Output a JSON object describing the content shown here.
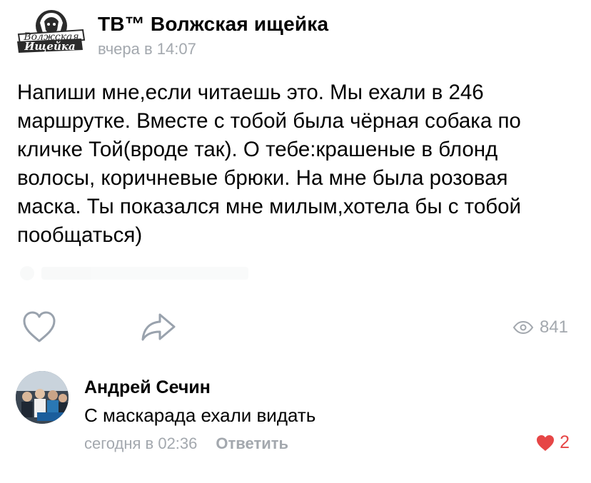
{
  "post": {
    "group_name": "ТВ™ Волжская ищейка",
    "time": "вчера в 14:07",
    "logo_text": {
      "line1": "Волжская",
      "line2": "Ищейка"
    },
    "text": "Напиши мне,если читаешь это. Мы ехали в 246 маршрутке. Вместе с тобой была чёрная собака по кличке Той(вроде так). О тебе:крашеные в блонд волосы, коричневые брюки. На мне была розовая маска. Ты показался мне милым,хотела бы с тобой пообщаться)",
    "views": "841"
  },
  "icons": {
    "like": "heart-outline-icon",
    "share": "share-arrow-icon",
    "views": "eye-icon",
    "comment_like": "heart-filled-icon"
  },
  "comment": {
    "author": "Андрей Сечин",
    "text": "С маскарада ехали видать",
    "time": "сегодня в 02:36",
    "reply_label": "Ответить",
    "likes": "2"
  },
  "colors": {
    "muted": "#a3a8ae",
    "like_red": "#e64646",
    "icon_gray": "#99a2ad"
  }
}
